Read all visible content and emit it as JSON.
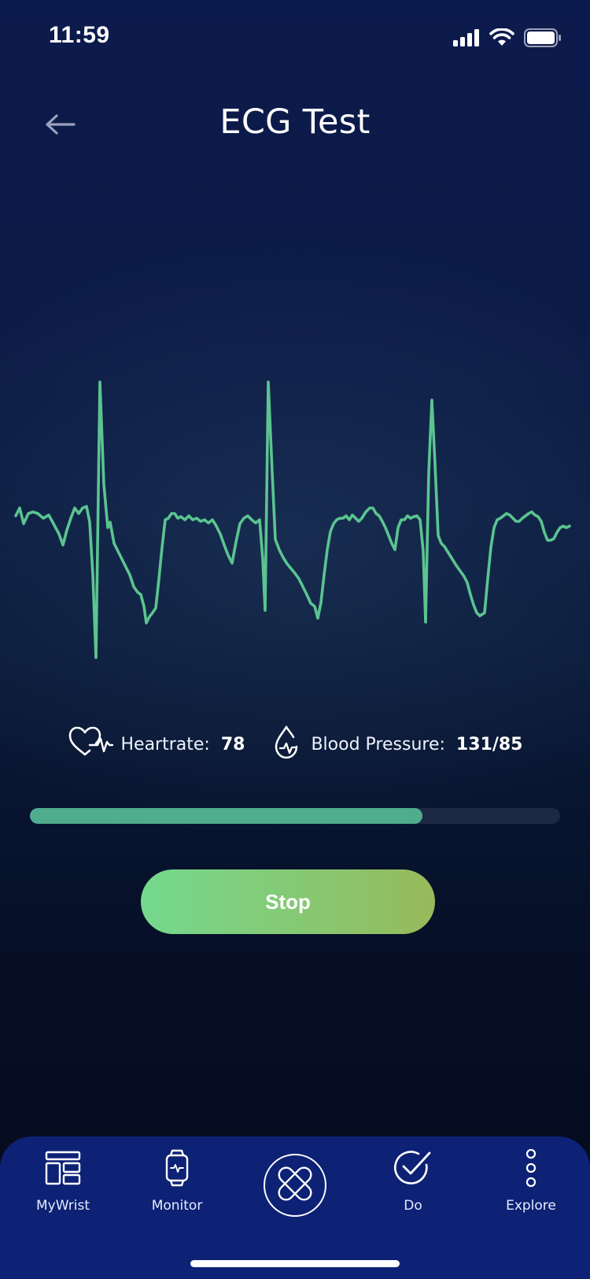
{
  "status_bar": {
    "time": "11:59",
    "icons": [
      "cellular-signal-icon",
      "wifi-icon",
      "battery-icon"
    ]
  },
  "header": {
    "back_icon": "arrow-left-icon",
    "title": "ECG Test"
  },
  "ecg": {
    "color": "#5bc48f",
    "waveform_icon": "ecg-waveform"
  },
  "metrics": {
    "heartrate": {
      "icon": "heart-pulse-icon",
      "label": "Heartrate:",
      "value": "78"
    },
    "blood_pressure": {
      "icon": "blood-drop-pulse-icon",
      "label": "Blood Pressure:",
      "value": "131/85"
    }
  },
  "progress": {
    "fraction": 0.74,
    "fill_color": "#4fad8e",
    "track_color": "#1d2942"
  },
  "stop_button": {
    "label": "Stop"
  },
  "tab_bar": {
    "background": "#0d2275",
    "items": [
      {
        "label": "MyWrist",
        "icon": "dashboard-layout-icon"
      },
      {
        "label": "Monitor",
        "icon": "smartwatch-icon"
      },
      {
        "label": "",
        "icon": "cross-logo-icon"
      },
      {
        "label": "Do",
        "icon": "check-circle-icon"
      },
      {
        "label": "Explore",
        "icon": "vertical-dots-icon"
      }
    ]
  },
  "colors": {
    "accent_green": "#74d98e",
    "background_top": "#0c1b4d",
    "background_bottom": "#040a1c"
  }
}
